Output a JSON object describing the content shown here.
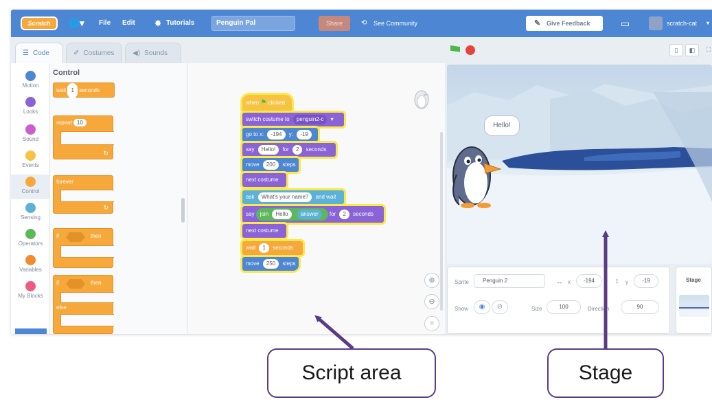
{
  "menu": {
    "logo": "Scratch",
    "file": "File",
    "edit": "Edit",
    "tutorials": "Tutorials",
    "project_title": "Penguin Pal",
    "share": "Share",
    "see_community": "See Community",
    "give_feedback": "Give Feedback",
    "username": "scratch-cat"
  },
  "tabs": {
    "code": "Code",
    "costumes": "Costumes",
    "sounds": "Sounds"
  },
  "categories": [
    {
      "label": "Motion",
      "color": "#4d86d2"
    },
    {
      "label": "Looks",
      "color": "#8a63d6"
    },
    {
      "label": "Sound",
      "color": "#c75fcf"
    },
    {
      "label": "Events",
      "color": "#f6c342"
    },
    {
      "label": "Control",
      "color": "#f6a83b"
    },
    {
      "label": "Sensing",
      "color": "#5cb1d6"
    },
    {
      "label": "Operators",
      "color": "#5bb85b"
    },
    {
      "label": "Variables",
      "color": "#f28b30"
    },
    {
      "label": "My Blocks",
      "color": "#f05a7e"
    }
  ],
  "palette": {
    "title": "Control",
    "wait": {
      "word": "wait",
      "value": "1",
      "unit": "seconds"
    },
    "repeat": {
      "word": "repeat",
      "value": "10"
    },
    "forever": "forever",
    "if1": {
      "word": "if",
      "then": "then"
    },
    "if2": {
      "word": "if",
      "then": "then",
      "else": "else"
    }
  },
  "script": {
    "hat": {
      "text": "when",
      "after": "clicked"
    },
    "switch_costume": {
      "text": "switch costume to",
      "value": "penguin2-c"
    },
    "goto": {
      "text": "go to x:",
      "x": "-194",
      "ylabel": "y:",
      "y": "-19"
    },
    "say_for": {
      "text": "say",
      "message": "Hello!",
      "for": "for",
      "secs": "2",
      "unit": "seconds"
    },
    "move1": {
      "text": "move",
      "value": "200",
      "unit": "steps"
    },
    "next_costume_1": "next costume",
    "ask": {
      "text": "ask",
      "question": "What's your name?",
      "after": "and wait"
    },
    "say_join": {
      "text": "say",
      "join": "join",
      "a": "Hello",
      "b": "answer",
      "for": "for",
      "secs": "2",
      "unit": "seconds"
    },
    "next_costume_2": "next costume",
    "wait": {
      "text": "wait",
      "value": "1",
      "unit": "seconds"
    },
    "move2": {
      "text": "move",
      "value": "250",
      "unit": "steps"
    }
  },
  "stage": {
    "speech": "Hello!"
  },
  "sprite_info": {
    "sprite_label": "Sprite",
    "sprite_name": "Penguin 2",
    "x_label": "x",
    "x": "-194",
    "y_label": "y",
    "y": "-19",
    "show_label": "Show",
    "size_label": "Size",
    "size": "100",
    "direction_label": "Direction",
    "direction": "90"
  },
  "stage_panel": {
    "label": "Stage"
  },
  "annotations": {
    "script_area": "Script area",
    "stage": "Stage"
  }
}
